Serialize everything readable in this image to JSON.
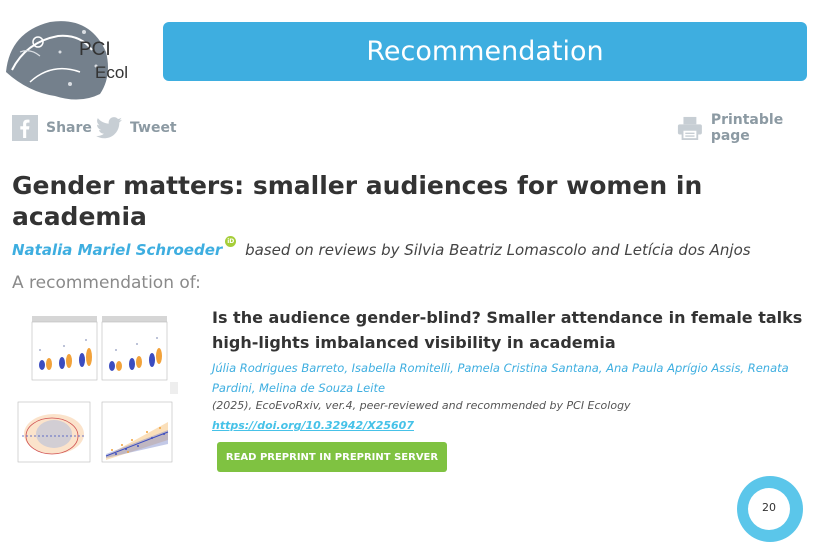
{
  "header": {
    "logo_text_line1": "PCI",
    "logo_text_line2": "Ecol",
    "banner_label": "Recommendation"
  },
  "share": {
    "facebook_label": "Share",
    "twitter_label": "Tweet",
    "print_label": "Printable page",
    "facebook_icon": "facebook-icon",
    "twitter_icon": "twitter-icon",
    "print_icon": "printer-icon"
  },
  "recommendation": {
    "title": "Gender matters: smaller audiences for women in academia",
    "recommender": "Natalia Mariel Schroeder",
    "orcid_label": "iD",
    "based_on": "based on reviews by Silvia Beatriz Lomascolo and Letícia dos Anjos"
  },
  "preprint": {
    "section_label": "A recommendation of:",
    "title": "Is the audience gender-blind? Smaller attendance in female talks high-lights imbalanced visibility in academia",
    "authors": "Júlia Rodrigues Barreto, Isabella Romitelli, Pamela Cristina Santana, Ana Paula Aprígio Assis, Renata Pardini, Melina de Souza Leite",
    "meta": "(2025), EcoEvoRxiv, ver.4, peer-reviewed and recommended by PCI Ecology",
    "doi": "https://doi.org/10.32942/X25607",
    "button_label": "READ PREPRINT IN PREPRINT SERVER"
  },
  "badge": {
    "value": "20"
  },
  "colors": {
    "accent": "#3eaee0",
    "button": "#7fc241",
    "orcid": "#a6ce39"
  }
}
